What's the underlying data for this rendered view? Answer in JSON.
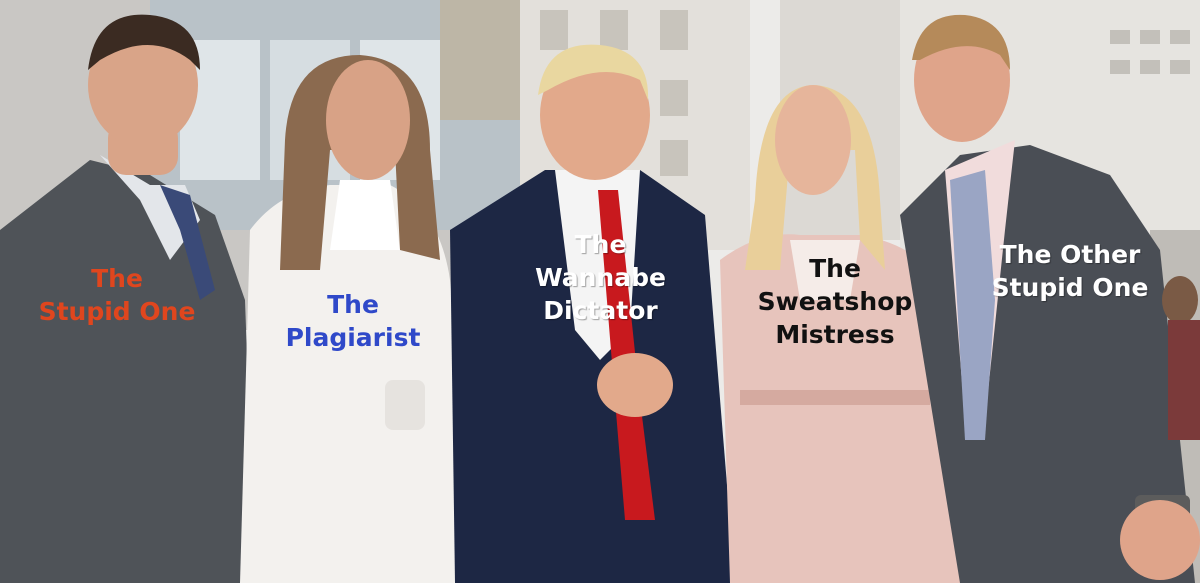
{
  "captions": [
    {
      "lines": [
        "The",
        "Stupid One"
      ],
      "color": "#e0461e"
    },
    {
      "lines": [
        "The",
        "Plagiarist"
      ],
      "color": "#2f49c9"
    },
    {
      "lines": [
        "The",
        "Wannabe",
        "Dictator"
      ],
      "color": "#ffffff"
    },
    {
      "lines": [
        "The",
        "Sweatshop",
        "Mistress"
      ],
      "color": "#111111"
    },
    {
      "lines": [
        "The Other",
        "Stupid One"
      ],
      "color": "#ffffff"
    }
  ],
  "colors": {
    "sky": "#ecebe9",
    "building": "#c9c7c4",
    "suit_grey": "#4f5358",
    "suit_navy": "#1d2744",
    "coat_white": "#f3f1ee",
    "coat_pink": "#e7c4bc",
    "tie_red": "#c8191e",
    "skin": "#d9a488"
  }
}
